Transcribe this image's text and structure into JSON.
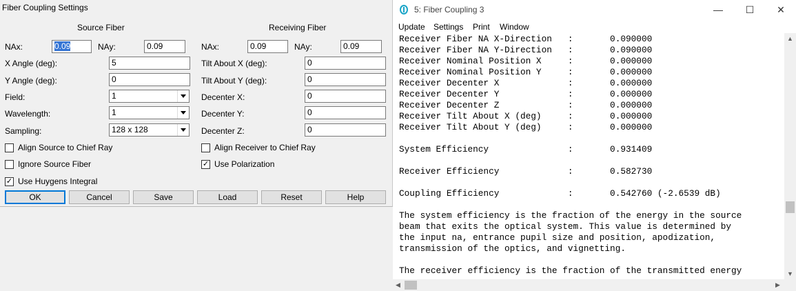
{
  "dialog": {
    "title": "Fiber Coupling Settings",
    "source_group": "Source Fiber",
    "receiving_group": "Receiving Fiber",
    "source": {
      "nax_label": "NAx:",
      "nax_value": "0.09",
      "nay_label": "NAy:",
      "nay_value": "0.09",
      "x_angle_label": "X Angle (deg):",
      "x_angle_value": "5",
      "y_angle_label": "Y Angle (deg):",
      "y_angle_value": "0",
      "field_label": "Field:",
      "field_value": "1",
      "wavelength_label": "Wavelength:",
      "wavelength_value": "1",
      "sampling_label": "Sampling:",
      "sampling_value": "128 x 128"
    },
    "receiving": {
      "nax_label": "NAx:",
      "nax_value": "0.09",
      "nay_label": "NAy:",
      "nay_value": "0.09",
      "tilt_x_label": "Tilt About X (deg):",
      "tilt_x_value": "0",
      "tilt_y_label": "Tilt About Y (deg):",
      "tilt_y_value": "0",
      "decenter_x_label": "Decenter X:",
      "decenter_x_value": "0",
      "decenter_y_label": "Decenter Y:",
      "decenter_y_value": "0",
      "decenter_z_label": "Decenter Z:",
      "decenter_z_value": "0"
    },
    "checkboxes": {
      "align_source": {
        "label": "Align Source to Chief Ray",
        "checked": false
      },
      "ignore_source": {
        "label": "Ignore Source Fiber",
        "checked": false
      },
      "use_huygens": {
        "label": "Use Huygens Integral",
        "checked": true
      },
      "align_receiver": {
        "label": "Align Receiver to Chief Ray",
        "checked": false
      },
      "use_polarization": {
        "label": "Use Polarization",
        "checked": true
      }
    },
    "buttons": {
      "ok": "OK",
      "cancel": "Cancel",
      "save": "Save",
      "load": "Load",
      "reset": "Reset",
      "help": "Help"
    }
  },
  "window": {
    "title": "5: Fiber Coupling 3",
    "controls": {
      "minimize": "—",
      "maximize": "☐",
      "close": "✕"
    },
    "menu": [
      "Update",
      "Settings",
      "Print",
      "Window"
    ],
    "output_text": "Receiver Fiber NA X-Direction   :       0.090000\nReceiver Fiber NA Y-Direction   :       0.090000\nReceiver Nominal Position X     :       0.000000\nReceiver Nominal Position Y     :       0.000000\nReceiver Decenter X             :       0.000000\nReceiver Decenter Y             :       0.000000\nReceiver Decenter Z             :       0.000000\nReceiver Tilt About X (deg)     :       0.000000\nReceiver Tilt About Y (deg)     :       0.000000\n\nSystem Efficiency               :       0.931409\n\nReceiver Efficiency             :       0.582730\n\nCoupling Efficiency             :       0.542760 (-2.6539 dB)\n\nThe system efficiency is the fraction of the energy in the source\nbeam that exits the optical system. This value is determined by\nthe input na, entrance pupil size and position, apodization,\ntransmission of the optics, and vignetting.\n\nThe receiver efficiency is the fraction of the transmitted energy"
  }
}
